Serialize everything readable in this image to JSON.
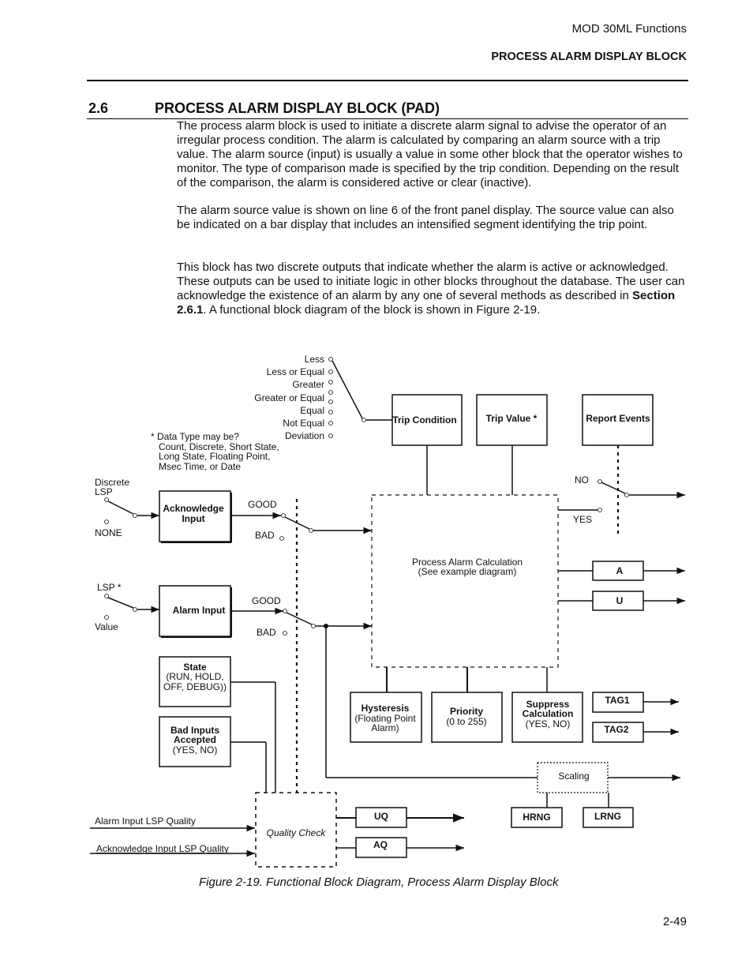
{
  "header": {
    "chapter": "MOD 30ML Functions",
    "section": "PROCESS ALARM DISPLAY BLOCK"
  },
  "section": {
    "number": "2.6",
    "title": "PROCESS ALARM DISPLAY BLOCK (PAD)"
  },
  "paragraphs": {
    "p1": "The process alarm block is used to initiate a discrete alarm signal to advise the operator of an irregular process condition. The alarm is calculated by comparing an alarm source with a trip value. The alarm source (input) is usually a value in some other block that the operator wishes to monitor. The type of comparison made is specified by the trip condition. Depending on the result of the comparison, the alarm is considered active or clear (inactive).",
    "p2": "The alarm source value is shown on line 6 of the front panel display. The source value can also be indicated on a bar display that includes an intensified segment identifying the trip point.",
    "p3_before": "This block has two discrete outputs that indicate whether the alarm is active or acknowledged. These outputs can be used to initiate logic in other blocks throughout the database. The user can acknowledge the existence of an alarm by any one of several methods as described in ",
    "p3_bold": "Section 2.6.1",
    "p3_after": ". A functional block diagram of the block is shown in Figure 2-19."
  },
  "diagram": {
    "trip_conditions": [
      "Less",
      "Less or Equal",
      "Greater",
      "Greater or Equal",
      "Equal",
      "Not Equal",
      "Deviation"
    ],
    "data_type_note": [
      "* Data Type may be?",
      "Count, Discrete, Short State,",
      "Long State, Floating Point,",
      "Msec Time, or Date"
    ],
    "blocks": {
      "trip_condition": "Trip Condition",
      "trip_value": "Trip Value *",
      "report_events": "Report Events",
      "acknowledge_input": [
        "Acknowledge",
        "Input"
      ],
      "alarm_input": "Alarm Input",
      "state": [
        "State",
        "(RUN, HOLD,",
        "OFF, DEBUG))"
      ],
      "bad_inputs": [
        "Bad Inputs",
        "Accepted",
        "(YES, NO)"
      ],
      "calc": [
        "Process Alarm Calculation",
        "(See example diagram)"
      ],
      "hysteresis": [
        "Hysteresis",
        "(Floating Point",
        "Alarm)"
      ],
      "priority": [
        "Priority",
        "(0 to 255)"
      ],
      "suppress": [
        "Suppress",
        "Calculation",
        "(YES, NO)"
      ],
      "out_a": "A",
      "out_u": "U",
      "tag1": "TAG1",
      "tag2": "TAG2",
      "scaling": "Scaling",
      "hrng": "HRNG",
      "lrng": "LRNG",
      "quality_check": "Quality Check",
      "uq": "UQ",
      "aq": "AQ"
    },
    "labels": {
      "discrete_lsp": [
        "Discrete",
        "LSP"
      ],
      "none": "NONE",
      "lsp_star": "LSP *",
      "value": "Value",
      "good": "GOOD",
      "bad": "BAD",
      "no": "NO",
      "yes": "YES",
      "alarm_input_lsp_quality": "Alarm Input LSP Quality",
      "ack_input_lsp_quality": "Acknowledge Input LSP Quality"
    }
  },
  "caption": "Figure 2-19.  Functional Block Diagram, Process Alarm Display Block",
  "page_number": "2-49"
}
